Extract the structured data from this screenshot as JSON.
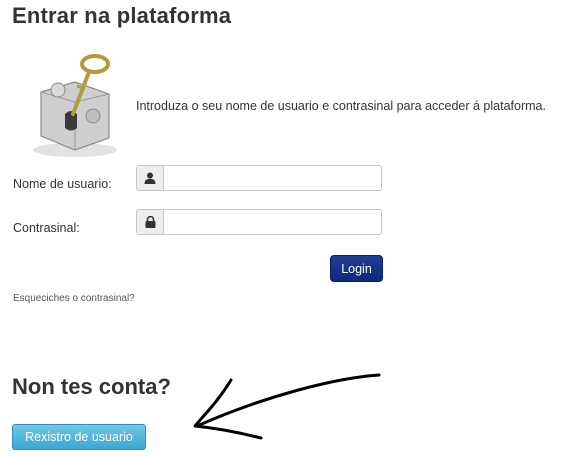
{
  "login": {
    "title": "Entrar na plataforma",
    "intro_text": "Introduza o seu nome de usuario e contrasinal para acceder á plataforma.",
    "username_label": "Nome de usuario:",
    "username_value": "",
    "password_label": "Contrasinal:",
    "password_value": "",
    "login_button": "Login",
    "forgot_link": "Esqueciches o contrasinal?"
  },
  "signup": {
    "title": "Non tes conta?",
    "register_button": "Rexistro de usuario"
  },
  "icons": {
    "image": "key-puzzle-image",
    "username": "user-icon",
    "password": "lock-icon",
    "annotation": "hand-drawn-arrow"
  },
  "colors": {
    "login_button": "#0d2c7e",
    "register_button": "#4ab0da",
    "text": "#333333"
  }
}
